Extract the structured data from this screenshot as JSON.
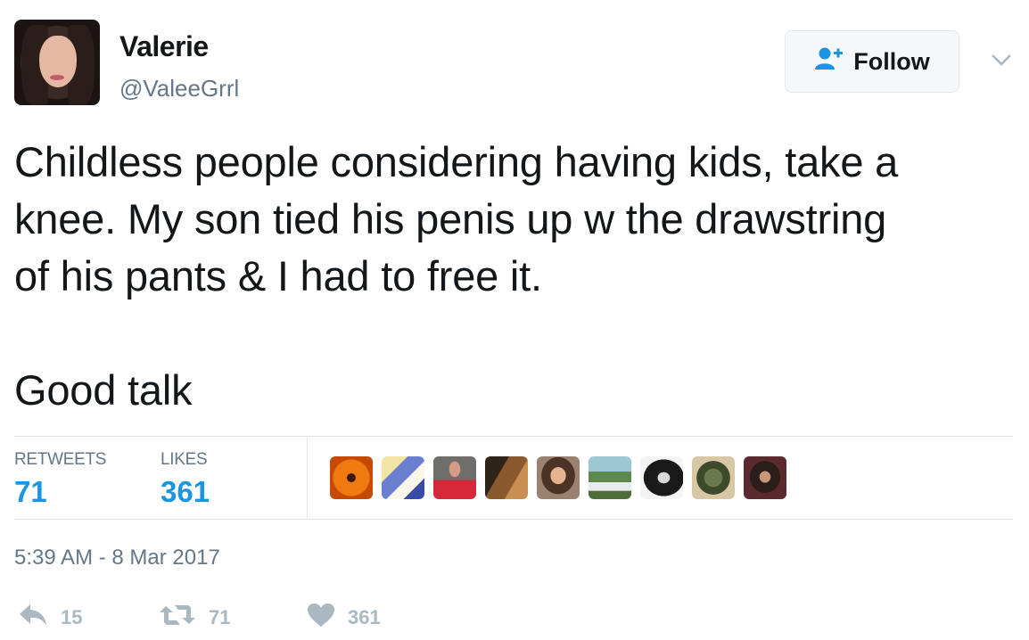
{
  "author": {
    "name": "Valerie",
    "handle": "@ValeeGrrl"
  },
  "follow_button": {
    "label": "Follow",
    "icon": "add-user-icon"
  },
  "menu_icon": "chevron-down-icon",
  "tweet": {
    "text": "Childless people considering having kids, take a\nknee. My son tied his penis up w the drawstring\nof his pants & I had to free it.\n\nGood talk"
  },
  "stats": {
    "retweets_label": "RETWEETS",
    "retweets_value": "71",
    "likes_label": "LIKES",
    "likes_value": "361"
  },
  "liked_by_avatars": [
    {
      "name": "orange-flower-avatar"
    },
    {
      "name": "anime-character-avatar"
    },
    {
      "name": "woman-red-shirt-avatar"
    },
    {
      "name": "horse-avatar"
    },
    {
      "name": "woman-selfie-avatar"
    },
    {
      "name": "cabin-landscape-avatar"
    },
    {
      "name": "black-white-woman-avatar"
    },
    {
      "name": "illustration-avatar"
    },
    {
      "name": "woman-dark-avatar"
    }
  ],
  "timestamp": "5:39 AM - 8 Mar 2017",
  "actions": {
    "reply_count": "15",
    "retweet_count": "71",
    "like_count": "361"
  },
  "colors": {
    "accent": "#1b95e0",
    "muted": "#657786",
    "action_gray": "#aab8c2"
  }
}
